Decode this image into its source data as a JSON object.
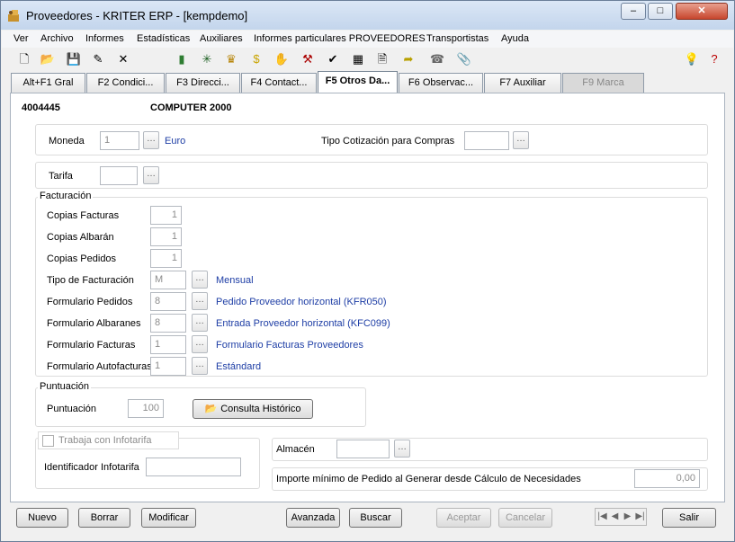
{
  "window": {
    "title": "Proveedores - KRITER ERP - [kempdemo]",
    "minimize": "–",
    "maximize": "□",
    "close": "✕"
  },
  "menu": [
    "Ver",
    "Archivo",
    "Informes",
    "Estadísticas",
    "Auxiliares",
    "Informes particulares PROVEEDORES",
    "Transportistas",
    "Ayuda"
  ],
  "tabs": [
    "Alt+F1 Gral",
    "F2 Condici...",
    "F3 Direcci...",
    "F4 Contact...",
    "F5 Otros Da...",
    "F6 Observac...",
    "F7 Auxiliar",
    "F9 Marca"
  ],
  "record": {
    "code": "4004445",
    "name": "COMPUTER 2000"
  },
  "moneda": {
    "label": "Moneda",
    "value": "1",
    "name": "Euro"
  },
  "cotizacion": {
    "label": "Tipo Cotización para Compras",
    "value": ""
  },
  "tarifa": {
    "label": "Tarifa",
    "value": ""
  },
  "facturacion": {
    "title": "Facturación",
    "copias_facturas": {
      "label": "Copias Facturas",
      "value": "1"
    },
    "copias_albaran": {
      "label": "Copias Albarán",
      "value": "1"
    },
    "copias_pedidos": {
      "label": "Copias Pedidos",
      "value": "1"
    },
    "tipo": {
      "label": "Tipo de Facturación",
      "value": "M",
      "desc": "Mensual"
    },
    "form_pedidos": {
      "label": "Formulario Pedidos",
      "value": "8",
      "desc": "Pedido Proveedor horizontal (KFR050)"
    },
    "form_albaranes": {
      "label": "Formulario Albaranes",
      "value": "8",
      "desc": "Entrada Proveedor horizontal (KFC099)"
    },
    "form_facturas": {
      "label": "Formulario Facturas",
      "value": "1",
      "desc": "Formulario Facturas Proveedores"
    },
    "form_autofacturas": {
      "label": "Formulario Autofacturas",
      "value": "1",
      "desc": "Estándard"
    }
  },
  "puntuacion": {
    "title": "Puntuación",
    "label": "Puntuación",
    "value": "100",
    "button": "Consulta Histórico"
  },
  "infotarifa": {
    "checkbox": "Trabaja con Infotarifa",
    "id_label": "Identificador Infotarifa",
    "id_value": ""
  },
  "almacen": {
    "label": "Almacén",
    "value": ""
  },
  "importe": {
    "label": "Importe mínimo de Pedido al Generar desde Cálculo de Necesidades",
    "value": "0,00"
  },
  "buttons": {
    "nuevo": "Nuevo",
    "borrar": "Borrar",
    "modificar": "Modificar",
    "avanzada": "Avanzada",
    "buscar": "Buscar",
    "aceptar": "Aceptar",
    "cancelar": "Cancelar",
    "salir": "Salir"
  },
  "nav": [
    "|◀",
    "◀",
    "▶",
    "▶|"
  ]
}
